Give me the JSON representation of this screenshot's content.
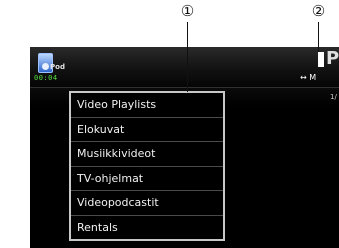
{
  "callouts": [
    "①",
    "②"
  ],
  "header": {
    "source_label": "Pod",
    "source_icon": "ipod-icon",
    "time": "00:04"
  },
  "right_pane": {
    "letter": "P",
    "toggle_label": "↔ M",
    "page_indicator": "1/"
  },
  "menu": {
    "items": [
      {
        "label": "Video Playlists"
      },
      {
        "label": "Elokuvat"
      },
      {
        "label": "Musiikkivideot"
      },
      {
        "label": "TV-ohjelmat"
      },
      {
        "label": "Videopodcastit"
      },
      {
        "label": "Rentals"
      }
    ]
  },
  "colors": {
    "screen_bg": "#000000",
    "list_border": "#c8c8c8",
    "time_color": "#56e040"
  }
}
